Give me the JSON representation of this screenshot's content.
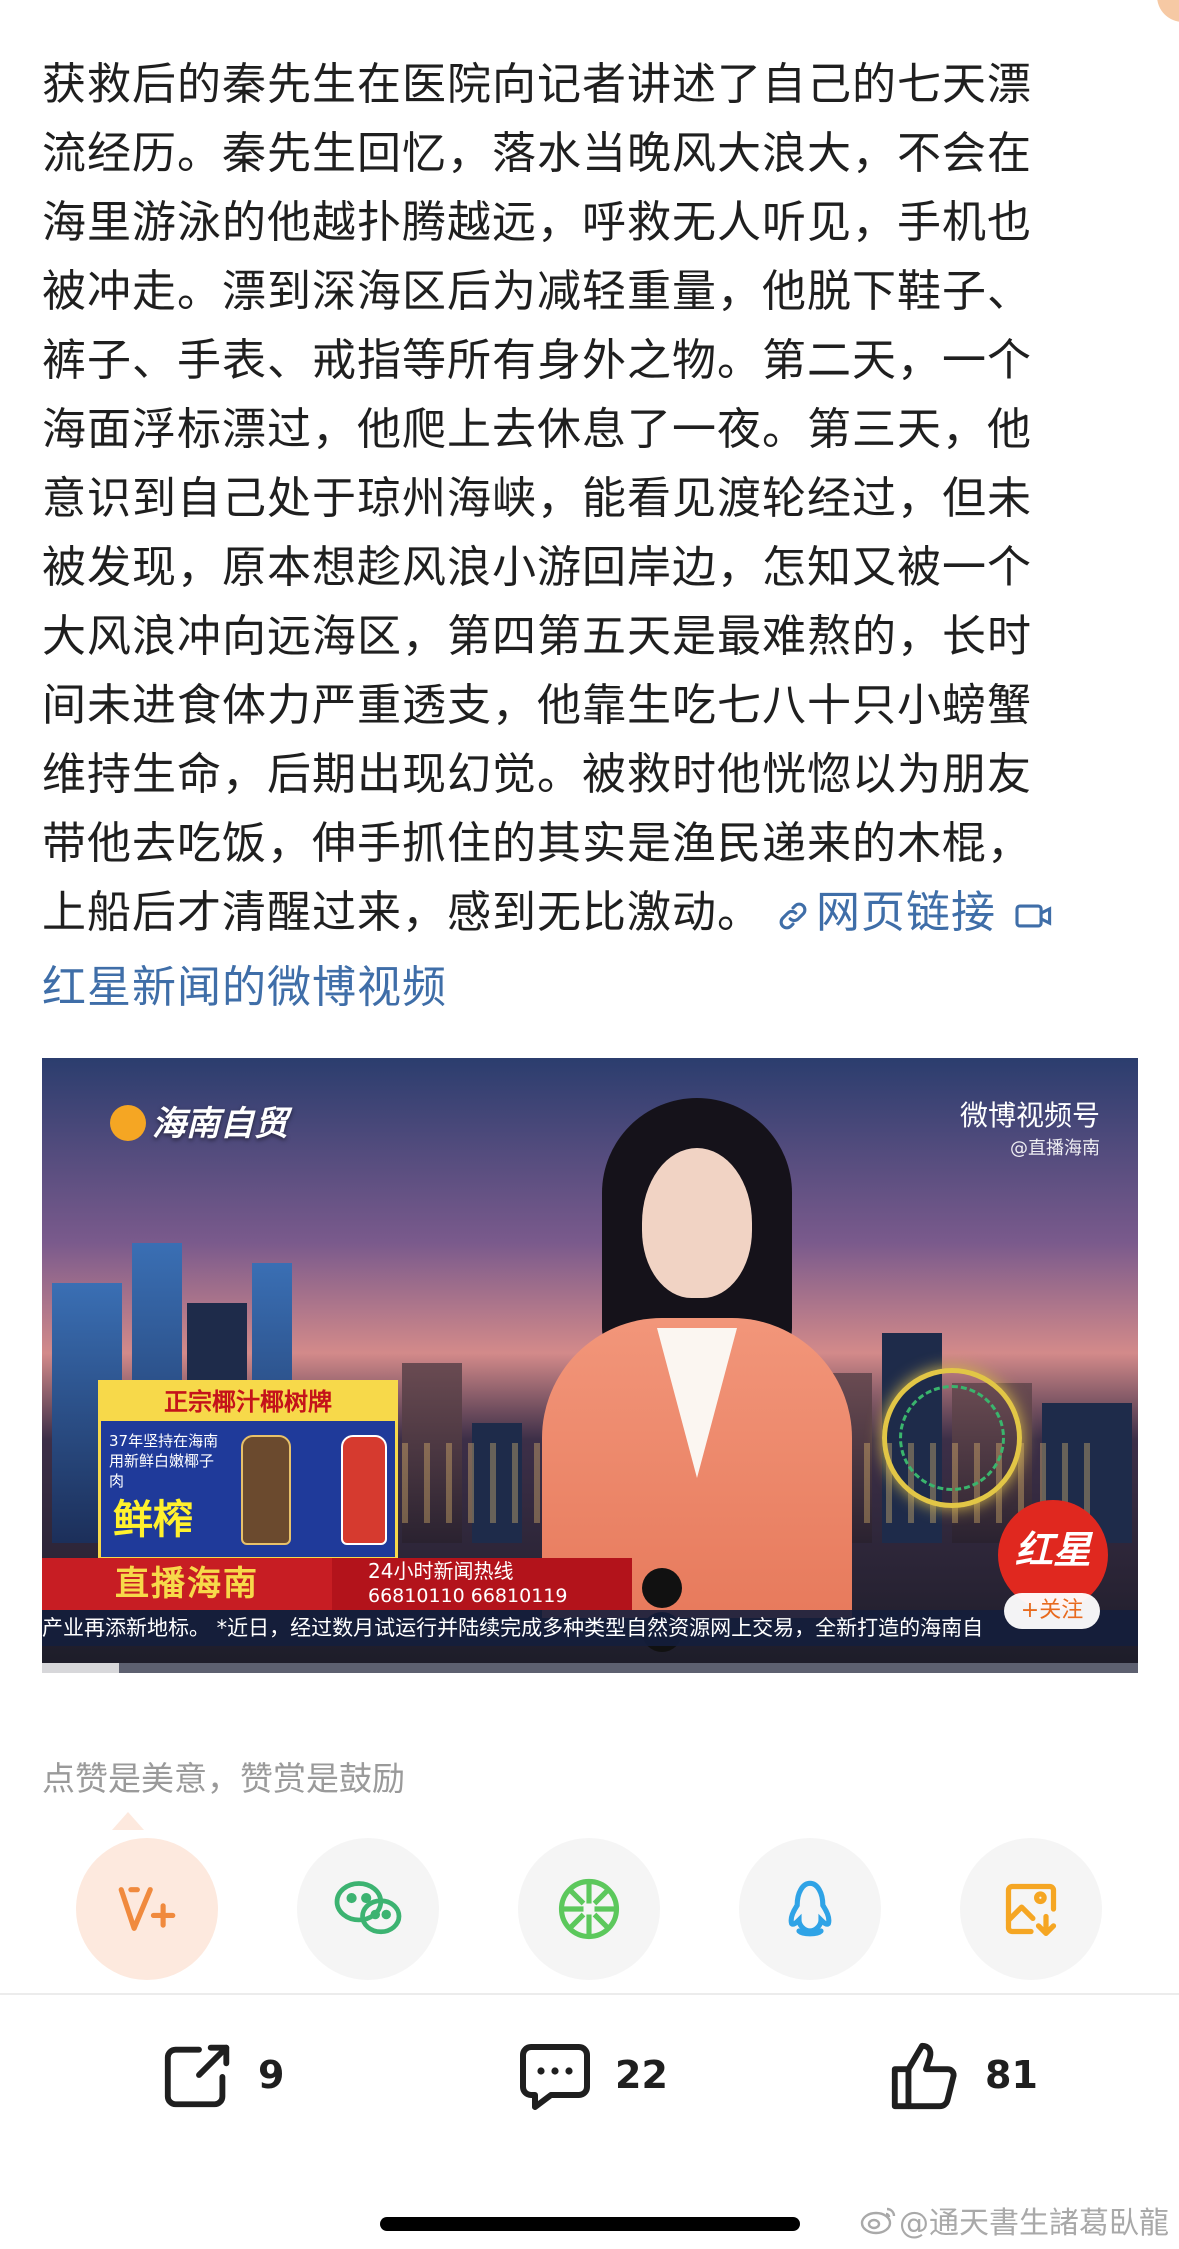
{
  "post": {
    "body": "获救后的秦先生在医院向记者讲述了自己的七天漂\n流经历。秦先生回忆，落水当晚风大浪大，不会在\n海里游泳的他越扑腾越远，呼救无人听见，手机也\n被冲走。漂到深海区后为减轻重量，他脱下鞋子、\n裤子、手表、戒指等所有身外之物。第二天，一个\n海面浮标漂过，他爬上去休息了一夜。第三天，他\n意识到自己处于琼州海峡，能看见渡轮经过，但未\n被发现，原本想趁风浪小游回岸边，怎知又被一个\n大风浪冲向远海区，第四第五天是最难熬的，长时\n间未进食体力严重透支，他靠生吃七八十只小螃蟹\n维持生命，后期出现幻觉。被救时他恍惚以为朋友\n带他去吃饭，伸手抓住的其实是渔民递来的木棍，\n上船后才清醒过来，感到无比激动。",
    "web_link_label": "网页链接",
    "video_link_label": "红星新闻的微博视频"
  },
  "video": {
    "station_logo": "海南自贸",
    "channel_name": "微博视频号",
    "channel_handle": "@直播海南",
    "ad_title": "正宗椰汁椰树牌",
    "ad_copy": "37年坚持在海南用新鲜白嫩椰子肉",
    "ad_big": "鲜榨",
    "program_name": "直播海南",
    "hotline_title": "24小时新闻热线",
    "hotline_numbers": "66810110  66810119",
    "ticker": "产业再添新地标。   *近日，经过数月试运行并陆续完成多种类型自然资源网上交易，全新打造的海南自",
    "source_badge": "红星",
    "follow_label": "+关注",
    "progress": 0.07
  },
  "reward": {
    "tip": "点赞是美意，赞赏是鼓励"
  },
  "share_buttons": [
    {
      "icon": "v-plus-icon",
      "color": "#f08a3e"
    },
    {
      "icon": "wechat-icon",
      "color": "#3cb371"
    },
    {
      "icon": "moments-icon",
      "color": "#5cc85c"
    },
    {
      "icon": "qq-icon",
      "color": "#2fa3e6"
    },
    {
      "icon": "save-image-icon",
      "color": "#f5a623"
    }
  ],
  "actions": {
    "repost_count": "9",
    "comment_count": "22",
    "like_count": "81"
  },
  "watermark": "@通天書生諸葛臥龍"
}
